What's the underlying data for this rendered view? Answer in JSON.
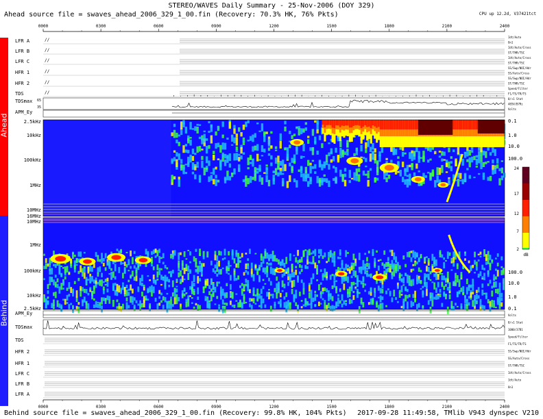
{
  "title": "STEREO/WAVES Daily Summary - 25-Nov-2006 (DOY 329)",
  "ahead_source": "Ahead source file = swaves_ahead_2006_329_1_00.fin (Recovery: 70.3% HK, 76% Pkts)",
  "behind_source": "Behind source file = swaves_ahead_2006_329_1_00.fin (Recovery: 99.8% HK, 104% Pkts)",
  "footer_right": "2017-09-28 11:49:58, TMlib V943 dynspec V210",
  "cpu_status": "CPU up 12.2d, V37421tct",
  "spacecraft": {
    "ahead": "Ahead",
    "behind": "Behind",
    "ahead_color": "#ff0000",
    "behind_color": "#1e1eff"
  },
  "time_ticks": [
    "0000",
    "0300",
    "0600",
    "0900",
    "1200",
    "1500",
    "1800",
    "2100",
    "2400"
  ],
  "ahead_rows": [
    "LFR A",
    "LFR B",
    "LFR C",
    "HFR 1",
    "HFR 2",
    "TDS",
    "TDSmax",
    "APM_Ey"
  ],
  "behind_rows": [
    "APM_Ey",
    "TDSmax",
    "TDS",
    "HFR 2",
    "HFR 1",
    "LFR C",
    "LFR B",
    "LFR A"
  ],
  "tdsmax_ticks": [
    "65",
    "35"
  ],
  "ahead_freq_labels": [
    "2.5kHz",
    "10kHz",
    "100kHz",
    "1MHz",
    "10MHz",
    "16MHz"
  ],
  "behind_freq_labels": [
    "10MHz",
    "1MHz",
    "100kHz",
    "10kHz",
    "2.5kHz"
  ],
  "ahead_right_scale": [
    "0.1",
    "1.0",
    "10.0",
    "100.0"
  ],
  "behind_right_scale": [
    "100.0",
    "10.0",
    "1.0",
    "0.1"
  ],
  "right_status_ahead": [
    "Idt/Auto",
    "On1",
    "Idt/Auto/Cross",
    "ST/THR/TSC",
    "Idt/Auto/Cross",
    "ST/THR/TSC",
    "SS/Swp/NOI/Hdr",
    "SS/Auto/Cross",
    "SS/Swp/NOI/Hdr",
    "ST/THR/TSC",
    "Speed/Filter",
    "F1/TS/TR/TS",
    "0/+1 Stat",
    "485V/B7Ri",
    "Volts"
  ],
  "right_status_behind": [
    "Volts",
    "0/+1 Stat",
    "1000/37B1",
    "Speed/Filter",
    "F1/TS/TR/TS",
    "SS/Swp/NOI/Hdr",
    "SS/Auto/Cross",
    "ST/THR/TSC",
    "Idt/Auto/Cross",
    "Idt/Auto",
    "On1"
  ],
  "colorbar": {
    "label": "dB",
    "ticks": [
      "24",
      "17",
      "12",
      "7",
      "2"
    ]
  },
  "colors": {
    "background": "#1010ff",
    "quiet": "#1010ff",
    "low": "#20c0ff",
    "mid": "#40ff40",
    "high": "#ffff00",
    "peak": "#ff2000",
    "max": "#600000"
  },
  "chart_data": [
    {
      "type": "heatmap",
      "title": "STEREO/WAVES Daily Summary - 25-Nov-2006 (DOY 329)",
      "panel": "Ahead",
      "x": [
        "0000",
        "0300",
        "0600",
        "0900",
        "1200",
        "1500",
        "1800",
        "2100",
        "2400"
      ],
      "xlim": [
        "0000",
        "2400"
      ],
      "y_tick_labels": [
        "2.5kHz",
        "10kHz",
        "100kHz",
        "1MHz",
        "10MHz",
        "16MHz"
      ],
      "yscale": "log",
      "colorbar_label": "dB",
      "colorbar_ticks": [
        24,
        17,
        12,
        7,
        2
      ],
      "data_gap": [
        "0000",
        "0650"
      ],
      "bursts_utc_hours": [
        15.5,
        17.3,
        19.0,
        20.5,
        21.5
      ]
    },
    {
      "type": "heatmap",
      "panel": "Behind",
      "x": [
        "0000",
        "0300",
        "0600",
        "0900",
        "1200",
        "1500",
        "1800",
        "2100",
        "2400"
      ],
      "xlim": [
        "0000",
        "2400"
      ],
      "y_tick_labels": [
        "10MHz",
        "1MHz",
        "100kHz",
        "10kHz",
        "2.5kHz"
      ],
      "yscale": "log",
      "colorbar_label": "dB",
      "colorbar_ticks": [
        24,
        17,
        12,
        7,
        2
      ],
      "bursts_utc_hours": [
        2.0,
        3.5,
        5.0,
        12.3,
        15.5,
        17.5,
        20.5,
        21.5
      ]
    }
  ]
}
